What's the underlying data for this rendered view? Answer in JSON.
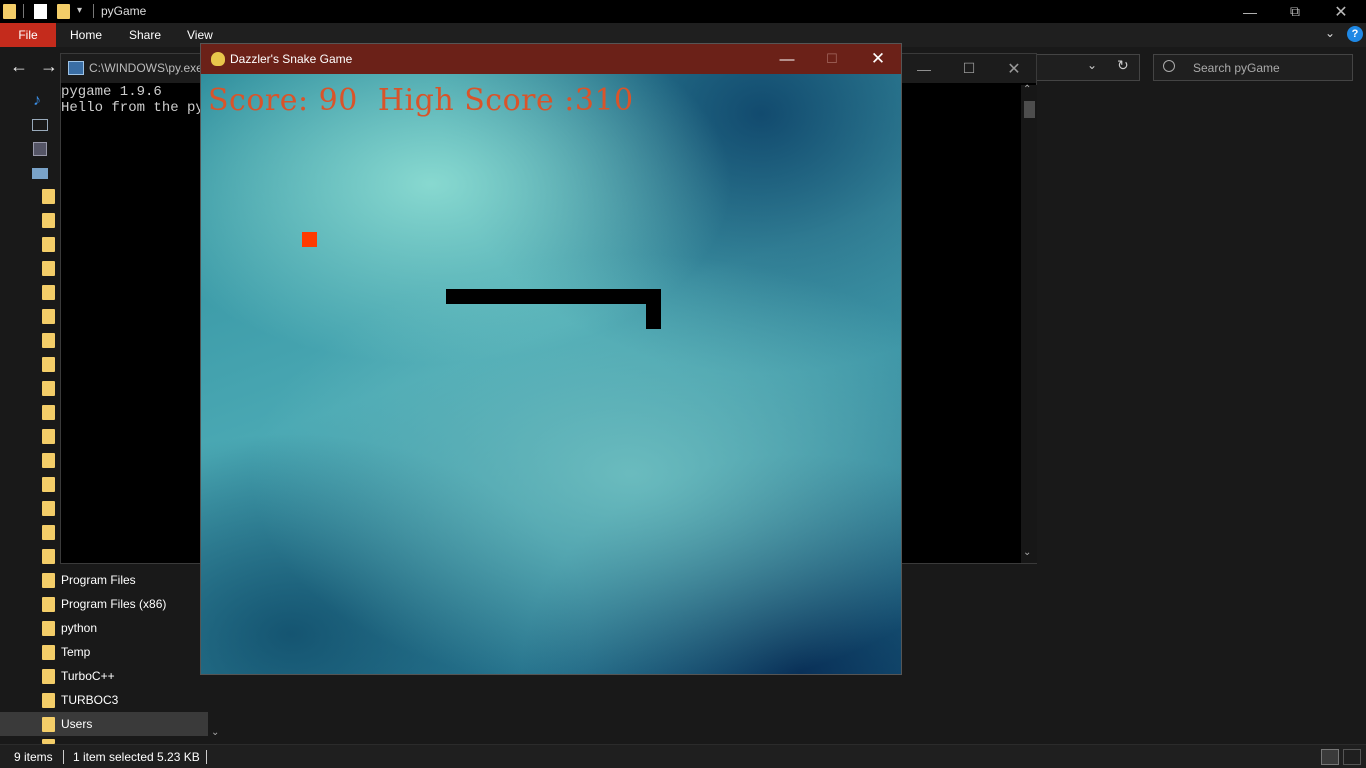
{
  "explorer": {
    "title": "pyGame",
    "menu": {
      "file": "File",
      "home": "Home",
      "share": "Share",
      "view": "View"
    },
    "help": "?",
    "search": {
      "placeholder": "Search pyGame"
    },
    "sidebar": {
      "items": [
        {
          "label": "Program Files"
        },
        {
          "label": "Program Files (x86)"
        },
        {
          "label": "python"
        },
        {
          "label": "Temp"
        },
        {
          "label": "TurboC++"
        },
        {
          "label": "TURBOC3"
        },
        {
          "label": "Users",
          "selected": true
        }
      ]
    },
    "status": {
      "item_count": "9 items",
      "selection": "1 item selected  5.23 KB"
    }
  },
  "console": {
    "title": "C:\\WINDOWS\\py.exe",
    "lines": [
      "pygame 1.9.6",
      "Hello from the pygame community. https://www.pygame.org/contribute.html"
    ]
  },
  "game": {
    "title": "Dazzler's Snake Game",
    "score_text": "Score: 90  High Score :310",
    "score": 90,
    "high_score": 310,
    "colors": {
      "titlebar": "#6b2118",
      "score": "#d9542a",
      "food": "#ff3b00",
      "snake": "#000000"
    }
  }
}
